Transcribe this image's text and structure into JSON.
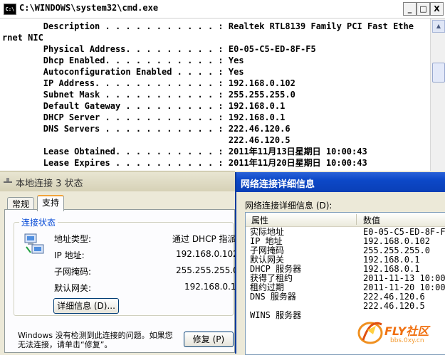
{
  "cmd": {
    "title": "C:\\WINDOWS\\system32\\cmd.exe",
    "system_icon_text": "C:\\",
    "buttons": {
      "minimize": "_",
      "maximize": "□",
      "close": "X"
    },
    "lines": [
      "        Description . . . . . . . . . . . : Realtek RTL8139 Family PCI Fast Ethe",
      "rnet NIC",
      "        Physical Address. . . . . . . . . : E0-05-C5-ED-8F-F5",
      "        Dhcp Enabled. . . . . . . . . . . : Yes",
      "        Autoconfiguration Enabled . . . . : Yes",
      "        IP Address. . . . . . . . . . . . : 192.168.0.102",
      "        Subnet Mask . . . . . . . . . . . : 255.255.255.0",
      "        Default Gateway . . . . . . . . . : 192.168.0.1",
      "        DHCP Server . . . . . . . . . . . : 192.168.0.1",
      "        DNS Servers . . . . . . . . . . . : 222.46.120.6",
      "                                            222.46.120.5",
      "        Lease Obtained. . . . . . . . . . : 2011年11月13日星期日 10:00:43",
      "        Lease Expires . . . . . . . . . . : 2011年11月20日星期日 10:00:43"
    ]
  },
  "status_window": {
    "title": "本地连接 3 状态",
    "tabs": [
      "常规",
      "支持"
    ],
    "group_label": "连接状态",
    "rows": [
      {
        "label": "地址类型:",
        "value": "通过 DHCP 指派"
      },
      {
        "label": "IP 地址:",
        "value": "192.168.0.102"
      },
      {
        "label": "子网掩码:",
        "value": "255.255.255.0"
      },
      {
        "label": "默认网关:",
        "value": "192.168.0.1"
      }
    ],
    "details_button": "详细信息 (D)...",
    "message": "Windows 没有检测到此连接的问题。如果您无法连接，请单击“修复”。",
    "repair_button": "修复 (P)"
  },
  "details_window": {
    "title": "网络连接详细信息",
    "subtitle": "网络连接详细信息 (D):",
    "columns": [
      "属性",
      "数值"
    ],
    "rows": [
      {
        "property": "实际地址",
        "value": "E0-05-C5-ED-8F-F5"
      },
      {
        "property": "IP 地址",
        "value": "192.168.0.102"
      },
      {
        "property": "子网掩码",
        "value": "255.255.255.0"
      },
      {
        "property": "默认网关",
        "value": "192.168.0.1"
      },
      {
        "property": "DHCP 服务器",
        "value": "192.168.0.1"
      },
      {
        "property": "获得了租约",
        "value": "2011-11-13 10:00:43"
      },
      {
        "property": "租约过期",
        "value": "2011-11-20 10:00:43"
      },
      {
        "property": "DNS 服务器",
        "value": "222.46.120.6"
      },
      {
        "property": "",
        "value": "222.46.120.5"
      },
      {
        "property": "WINS 服务器",
        "value": ""
      }
    ]
  },
  "watermark": {
    "brand": "FLY社区",
    "url": "bbs.0xy.cn"
  }
}
